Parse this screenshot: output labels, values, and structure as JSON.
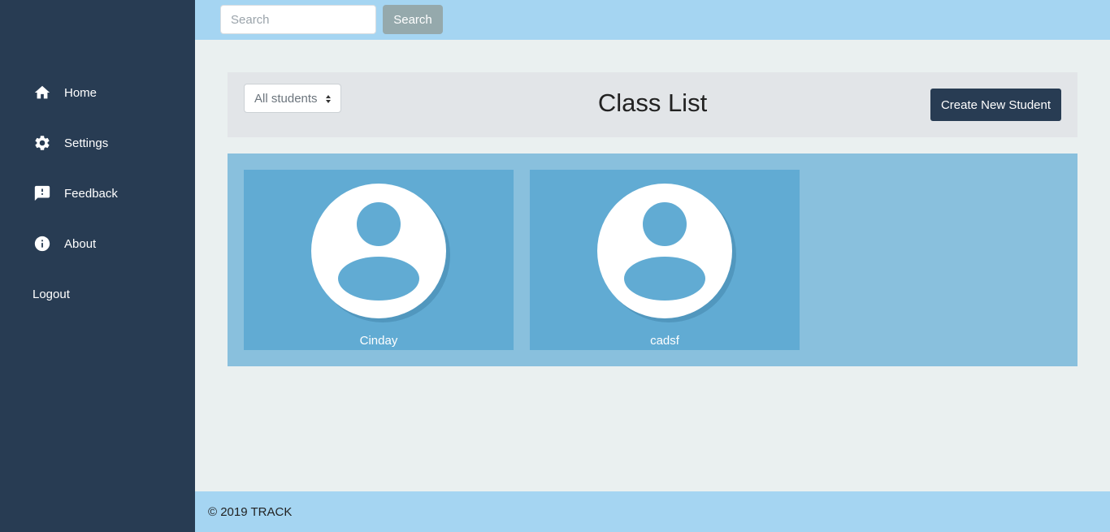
{
  "sidebar": {
    "items": [
      {
        "label": "Home",
        "icon": "home-icon"
      },
      {
        "label": "Settings",
        "icon": "gear-icon"
      },
      {
        "label": "Feedback",
        "icon": "feedback-icon"
      },
      {
        "label": "About",
        "icon": "info-icon"
      }
    ],
    "logout_label": "Logout"
  },
  "topbar": {
    "search_placeholder": "Search",
    "search_button_label": "Search"
  },
  "header": {
    "filter_selected": "All students",
    "title": "Class List",
    "create_button_label": "Create New Student"
  },
  "students": [
    {
      "name": "Cinday",
      "avatar": "user-avatar-icon"
    },
    {
      "name": "cadsf",
      "avatar": "user-avatar-icon"
    }
  ],
  "footer": {
    "copyright": "© 2019 TRACK"
  },
  "colors": {
    "sidebar_bg": "#283c53",
    "topbar_bg": "#a5d5f2",
    "grid_bg": "#89c0dd",
    "card_bg": "#61abd3",
    "primary_button": "#283c53",
    "search_button": "#95a9ac"
  }
}
